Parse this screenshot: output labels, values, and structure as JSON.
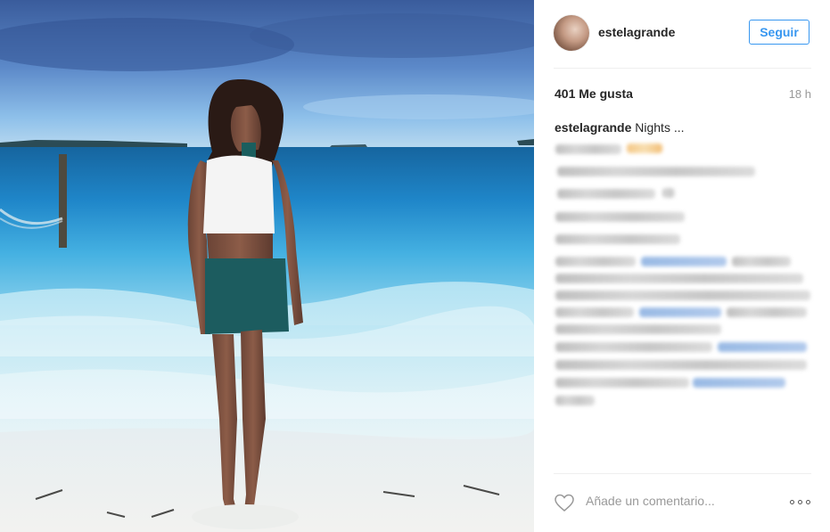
{
  "post": {
    "username": "estelagrande",
    "follow_label": "Seguir",
    "likes": "401 Me gusta",
    "time_ago": "18 h",
    "caption_user": "estelagrande",
    "caption_text": "Nights ...",
    "comment_placeholder": "Añade un comentario..."
  },
  "icons": {
    "like": "heart-outline-icon",
    "more": "more-options-icon"
  },
  "colors": {
    "accent": "#3897f0",
    "text": "#262626",
    "muted": "#999999",
    "divider": "#efefef"
  }
}
